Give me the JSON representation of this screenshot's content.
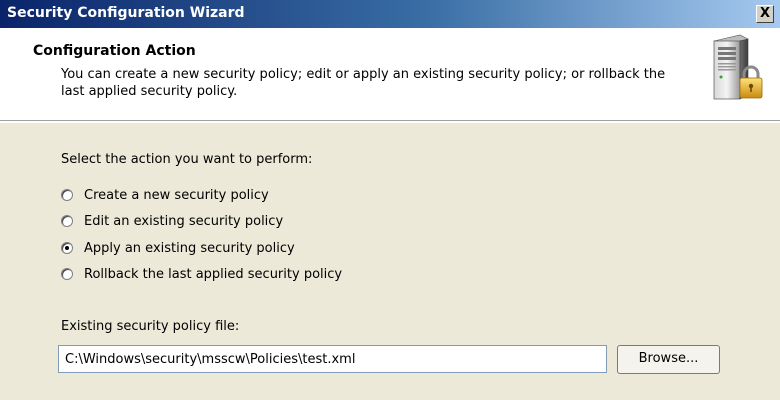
{
  "window": {
    "title": "Security Configuration Wizard",
    "close_label": "X"
  },
  "header": {
    "title": "Configuration Action",
    "description": "You can create a new security policy; edit or apply an existing security policy; or rollback the last applied security policy.",
    "icon": "server-lock-icon"
  },
  "body": {
    "prompt": "Select the action you want to perform:",
    "options": [
      {
        "label": "Create a new security policy",
        "checked": false
      },
      {
        "label": "Edit an existing security policy",
        "checked": false
      },
      {
        "label": "Apply an existing security policy",
        "checked": true
      },
      {
        "label": "Rollback the last applied security policy",
        "checked": false
      }
    ],
    "file_label": "Existing security policy file:",
    "file_value": "C:\\Windows\\security\\msscw\\Policies\\test.xml",
    "browse_label": "Browse..."
  },
  "colors": {
    "titlebar": "#0a246a",
    "dialog_bg": "#ece9d8",
    "header_bg": "#ffffff"
  }
}
